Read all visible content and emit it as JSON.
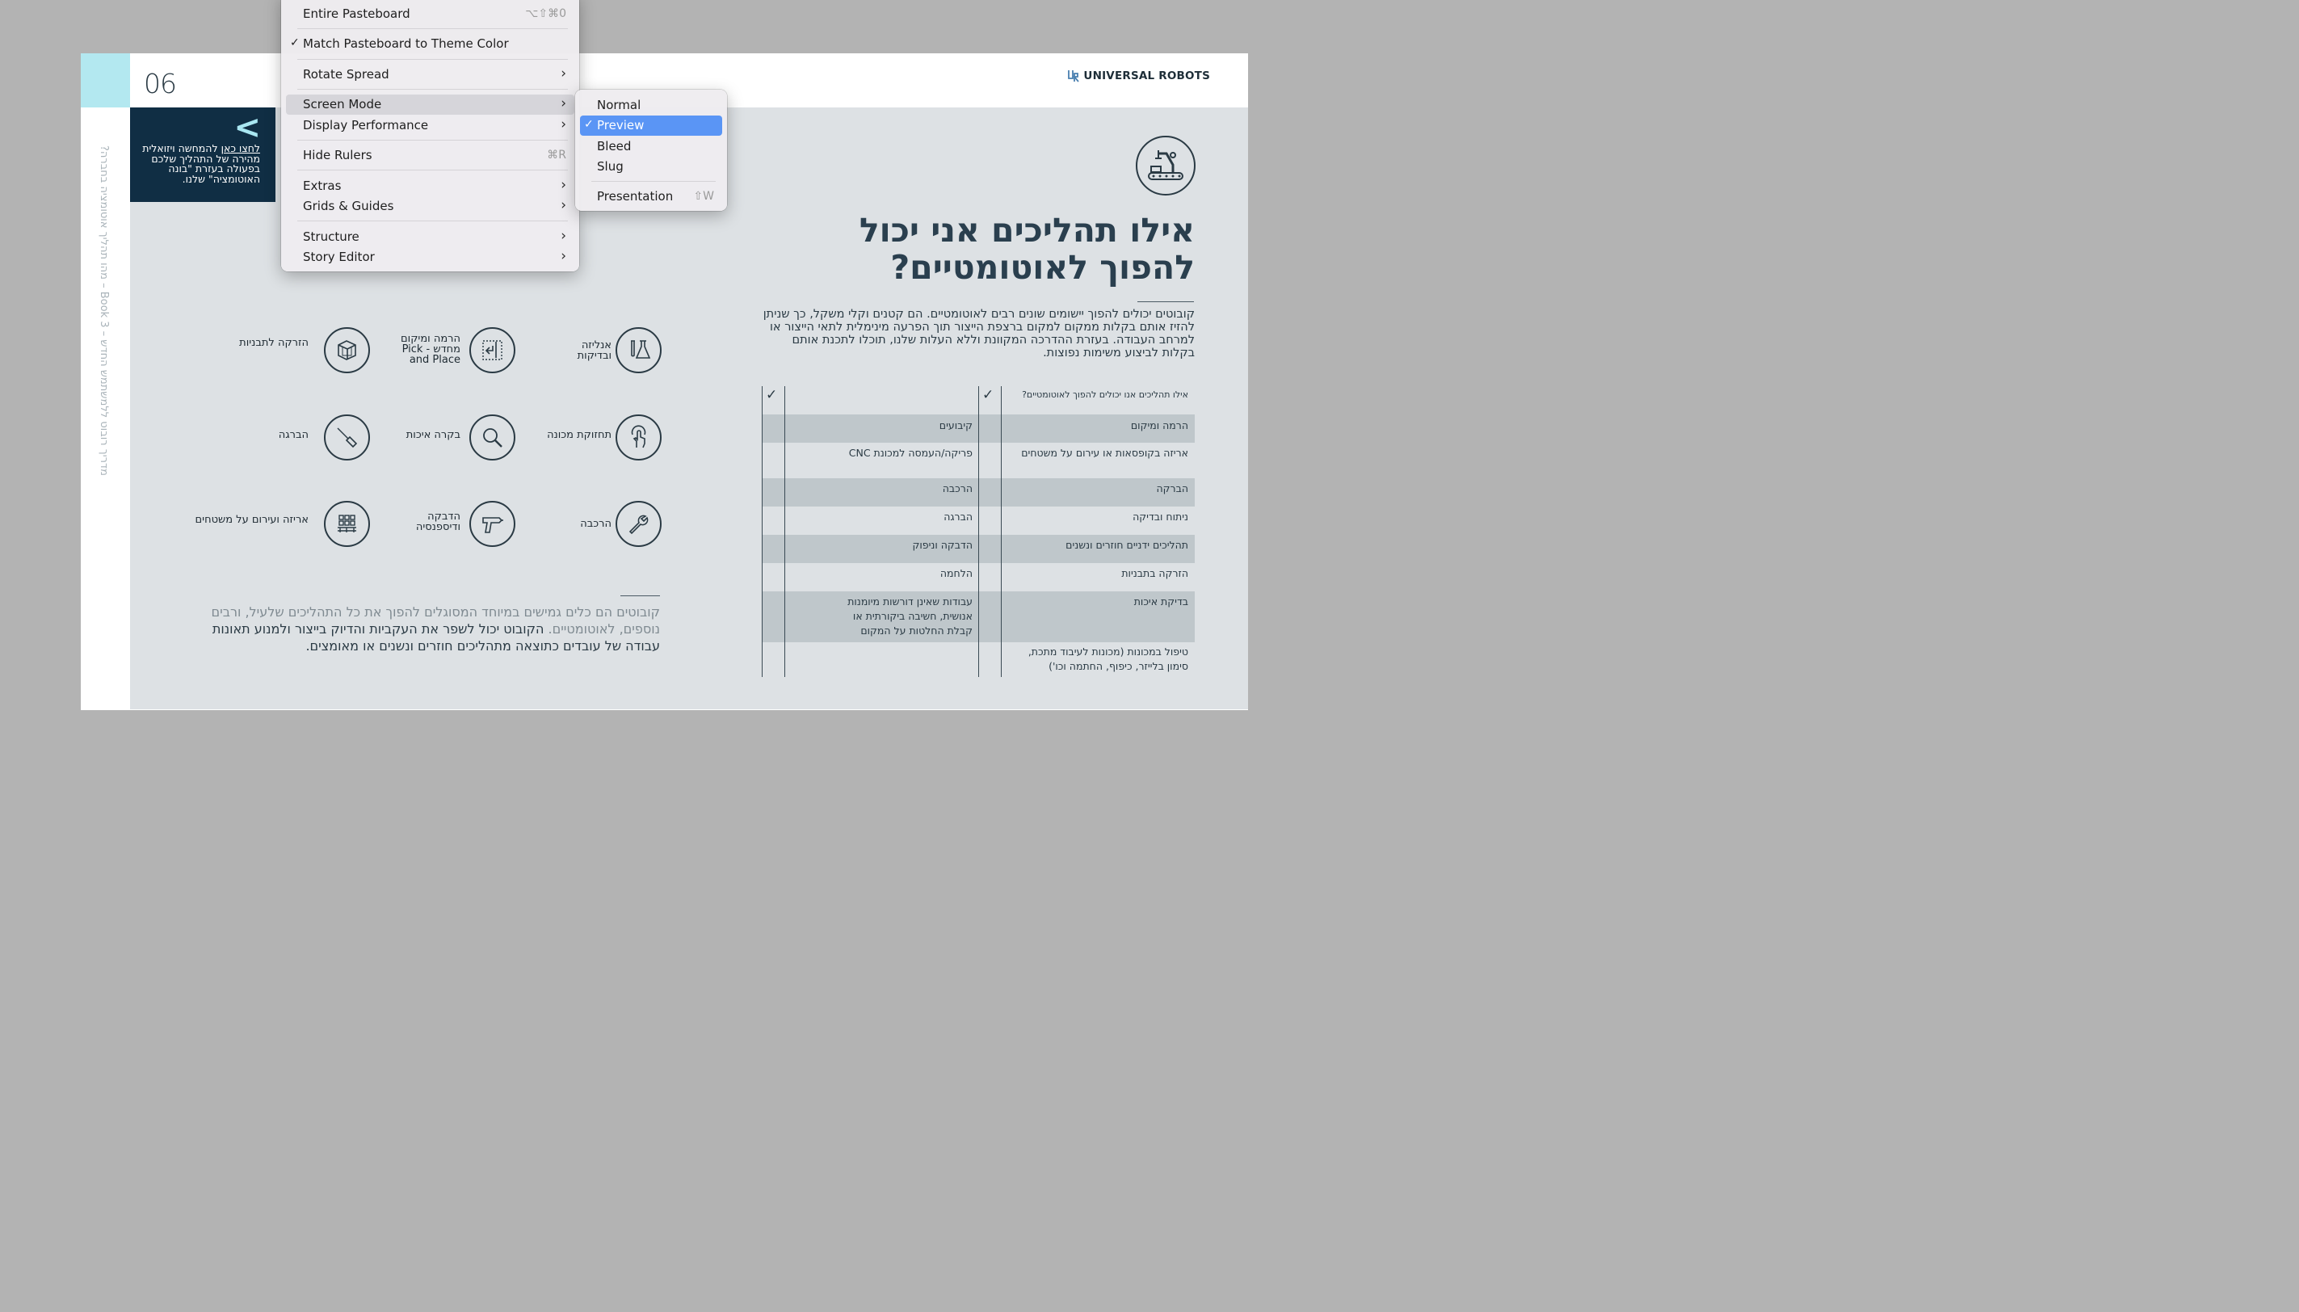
{
  "document": {
    "page_number": "06",
    "side_text": "מדריך רובוט ללמשתמש החדש – Book 3 – מהו תהליך אוטומציה בחברה?",
    "nav": {
      "arrow": "<",
      "link_text": "לחצו כאן",
      "text": "להמחשה ויזואלית מהירה של התהליך שלכם בפעולה בעזרת \"בונה האוטומציה\" שלנו."
    },
    "logo_text": "UNIVERSAL ROBOTS",
    "title": "אילו תהליכים אני יכול להפוך לאוטומטיים?",
    "intro": "קובוטים יכולים להפוך יישומים שונים רבים לאוטומטיים. הם קטנים וקלי משקל, כך שניתן להזיז אותם בקלות ממקום למקום ברצפת הייצור תוך הפרעה מינימלית לתאי הייצור או למרחב העבודה. בעזרת ההדרכה המקוונת וללא העלות שלנו, תוכלו לתכנת אותם בקלות לביצוע משימות נפוצות.",
    "table": {
      "header": "אילו תהליכים אנו יכולים להפוך לאוטומטיים?",
      "check": "✓",
      "rows": [
        {
          "right": "הרמה ומיקום",
          "left": "קיבועים"
        },
        {
          "right": "אריזה בקופסאות או עירום על משטחים",
          "left": "פריקה/העמסה למכונת CNC"
        },
        {
          "right": "הברקה",
          "left": "הרכבה"
        },
        {
          "right": "ניתוח ובדיקה",
          "left": "הברגה"
        },
        {
          "right": "תהליכים ידניים חוזרים ונשנים",
          "left": "הדבקה וניפוק"
        },
        {
          "right": "הזרקה בתבניות",
          "left": "הלחמה"
        },
        {
          "right": "בדיקת איכות",
          "left": "עבודות שאינן דורשות מיומנות אנושית, חשיבה ביקורתית או קבלת החלטות על המקום"
        },
        {
          "right": "טיפול במכונות (מכונות לעיבוד מתכת, סימון בלייזר, כיפוף, החתמה וכו')",
          "left": ""
        }
      ]
    },
    "icons": [
      {
        "label": "אנליזה ובדיקות"
      },
      {
        "label": "הרמה ומיקום מחדש - Pick and Place"
      },
      {
        "label": "הזרקה לתבניות"
      },
      {
        "label": "תחזוקת מכונה"
      },
      {
        "label": "בקרה איכות"
      },
      {
        "label": "הברגה"
      },
      {
        "label": "הרכבה"
      },
      {
        "label": "הדבקה ודיספנסיה"
      },
      {
        "label": "אריזה ועירום על משטחים"
      }
    ],
    "bottom_muted": "קובוטים הם כלים גמישים במיוחד המסוגלים להפוך את כל התהליכים שלעיל, ורבים נוספים, לאוטומטיים.",
    "bottom_rest": "הקובוט יכול לשפר את העקביות והדיוק בייצור ולמנוע תאונות עבודה של עובדים כתוצאה מתהליכים חוזרים ונשנים או מאומצים."
  },
  "menu": {
    "items": [
      {
        "label": "Entire Pasteboard",
        "shortcut": "⌥⇧⌘0"
      },
      {
        "label": "Match Pasteboard to Theme Color",
        "checked": "✓"
      },
      {
        "label": "Rotate Spread",
        "arrow": "›"
      },
      {
        "label": "Screen Mode",
        "arrow": "›"
      },
      {
        "label": "Display Performance",
        "arrow": "›"
      },
      {
        "label": "Hide Rulers",
        "shortcut": "⌘R"
      },
      {
        "label": "Extras",
        "arrow": "›"
      },
      {
        "label": "Grids & Guides",
        "arrow": "›"
      },
      {
        "label": "Structure",
        "arrow": "›"
      },
      {
        "label": "Story Editor",
        "arrow": "›"
      }
    ],
    "submenu": [
      {
        "label": "Normal"
      },
      {
        "label": "Preview",
        "checked": "✓"
      },
      {
        "label": "Bleed"
      },
      {
        "label": "Slug"
      },
      {
        "label": "Presentation",
        "shortcut": "⇧W"
      }
    ]
  }
}
